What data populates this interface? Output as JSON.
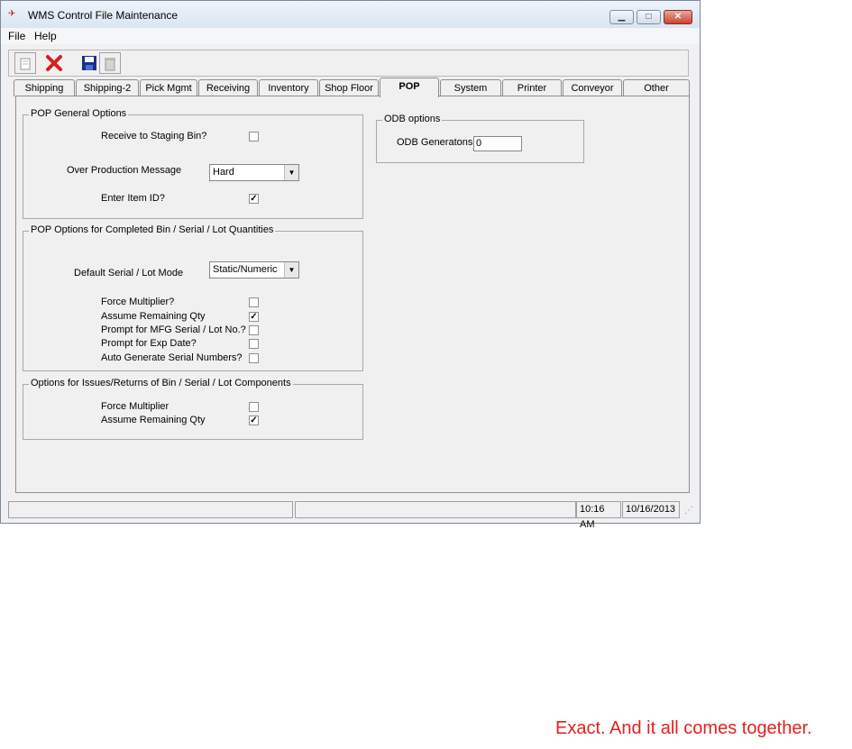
{
  "window": {
    "title": "WMS Control File Maintenance"
  },
  "menu": {
    "items": [
      "File",
      "Help"
    ]
  },
  "toolbar": {
    "icons": [
      "new-icon",
      "delete-x-icon",
      "save-icon",
      "trash-icon"
    ]
  },
  "tabs": [
    "Shipping",
    "Shipping-2",
    "Pick Mgmt",
    "Receiving",
    "Inventory",
    "Shop Floor",
    "POP",
    "System",
    "Printer",
    "Conveyor",
    "Other"
  ],
  "active_tab": "POP",
  "general": {
    "legend": "POP General Options",
    "receive_staging_label": "Receive to Staging Bin?",
    "receive_staging_checked": false,
    "over_production_label": "Over Production Message",
    "over_production_value": "Hard",
    "enter_item_label": "Enter Item ID?",
    "enter_item_checked": true
  },
  "completed": {
    "legend": "POP Options for Completed Bin / Serial / Lot Quantities",
    "serial_mode_label": "Default Serial / Lot Mode",
    "serial_mode_value": "Static/Numeric",
    "options": [
      {
        "label": "Force Multiplier?",
        "checked": false
      },
      {
        "label": "Assume Remaining Qty",
        "checked": true
      },
      {
        "label": "Prompt for MFG Serial / Lot No.?",
        "checked": false
      },
      {
        "label": "Prompt for Exp Date?",
        "checked": false
      },
      {
        "label": "Auto Generate Serial Numbers?",
        "checked": false
      }
    ]
  },
  "issues": {
    "legend": "Options for Issues/Returns of Bin / Serial / Lot Components",
    "options": [
      {
        "label": "Force Multiplier",
        "checked": false
      },
      {
        "label": "Assume Remaining Qty",
        "checked": true
      }
    ]
  },
  "odb": {
    "legend": "ODB options",
    "generations_label": "ODB Generatons:",
    "generations_value": "0"
  },
  "status": {
    "time": "10:16 AM",
    "date": "10/16/2013"
  },
  "tagline": "Exact. And it all comes together.",
  "colors": {
    "tagline": "#e2211c",
    "close_button": "#c8452e"
  }
}
